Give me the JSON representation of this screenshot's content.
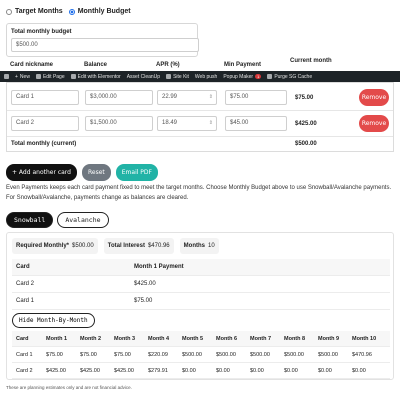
{
  "mode": {
    "options": [
      "Target Months",
      "Monthly Budget"
    ],
    "selected": "Monthly Budget"
  },
  "budget": {
    "label": "Total monthly budget",
    "value": "$500.00"
  },
  "table_header": {
    "nickname": "Card nickname",
    "balance": "Balance",
    "apr": "APR (%)",
    "min_payment": "Min Payment",
    "current_month": "Current month"
  },
  "adminbar": {
    "items": [
      "New",
      "Edit Page",
      "Edit with Elementor",
      "Asset CleanUp",
      "Site Kit",
      "Web push",
      "Popup Maker",
      "Purge SG Cache"
    ],
    "popup_badge": "1"
  },
  "cards": [
    {
      "name": "Card 1",
      "balance": "$3,000.00",
      "apr": "22.99",
      "min_payment": "$75.00",
      "current": "$75.00",
      "remove_label": "Remove"
    },
    {
      "name": "Card 2",
      "balance": "$1,500.00",
      "apr": "18.49",
      "min_payment": "$45.00",
      "current": "$425.00",
      "remove_label": "Remove"
    }
  ],
  "total": {
    "label": "Total monthly (current)",
    "value": "$500.00"
  },
  "buttons": {
    "add": "+ Add another card",
    "reset": "Reset",
    "email": "Email PDF"
  },
  "explanation": "Even Payments keeps each card payment fixed to meet the target months. Choose Monthly Budget above to use Snowball/Avalanche payments. For Snowball/Avalanche, payments change as balances are cleared.",
  "tabs": [
    "Snowball",
    "Avalanche"
  ],
  "active_tab": "Snowball",
  "stats": {
    "required_label": "Required Monthly*",
    "required_value": "$500.00",
    "interest_label": "Total Interest",
    "interest_value": "$470.96",
    "months_label": "Months",
    "months_value": "10"
  },
  "payment_table": {
    "headers": [
      "Card",
      "Month 1 Payment"
    ],
    "rows": [
      [
        "Card 2",
        "$425.00"
      ],
      [
        "Card 1",
        "$75.00"
      ]
    ]
  },
  "hide_button": "Hide Month-By-Month",
  "month_table": {
    "headers": [
      "Card",
      "Month 1",
      "Month 2",
      "Month 3",
      "Month 4",
      "Month 5",
      "Month 6",
      "Month 7",
      "Month 8",
      "Month 9",
      "Month 10"
    ],
    "rows": [
      [
        "Card 1",
        "$75.00",
        "$75.00",
        "$75.00",
        "$220.09",
        "$500.00",
        "$500.00",
        "$500.00",
        "$500.00",
        "$500.00",
        "$470.96"
      ],
      [
        "Card 2",
        "$425.00",
        "$425.00",
        "$425.00",
        "$279.91",
        "$0.00",
        "$0.00",
        "$0.00",
        "$0.00",
        "$0.00",
        "$0.00"
      ]
    ]
  },
  "disclaimer": "These are planning estimates only and are not financial advice."
}
